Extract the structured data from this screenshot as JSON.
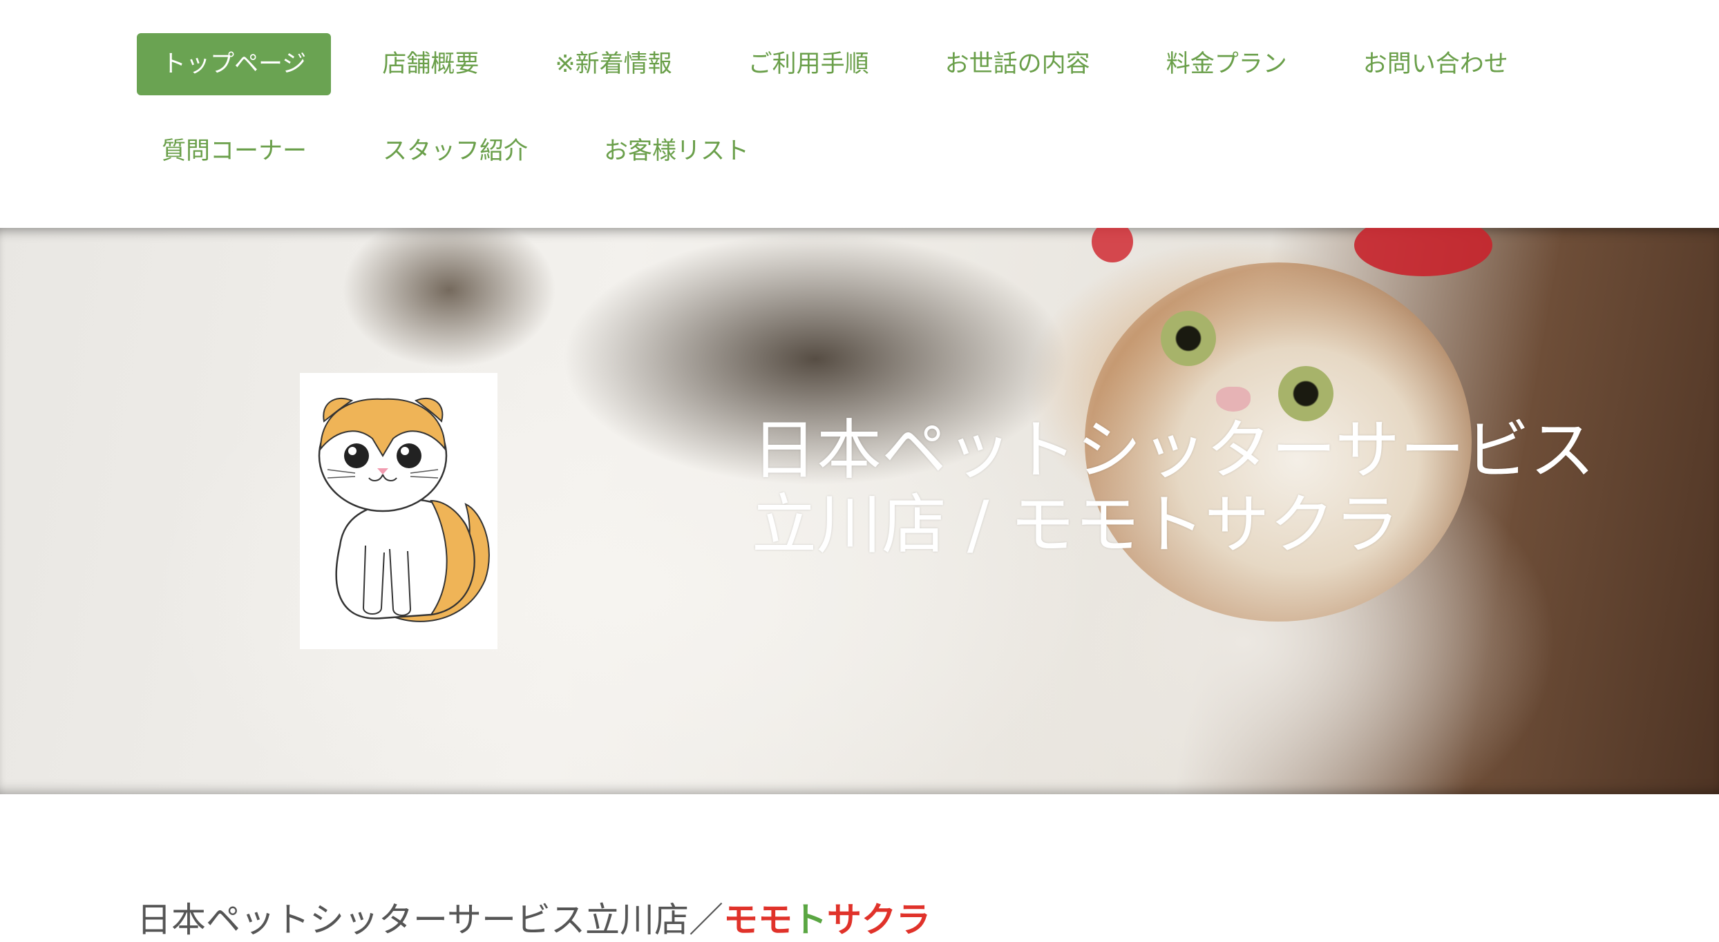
{
  "nav": {
    "items": [
      {
        "label": "トップページ",
        "active": true
      },
      {
        "label": "店舗概要"
      },
      {
        "label": "※新着情報"
      },
      {
        "label": "ご利用手順"
      },
      {
        "label": "お世話の内容"
      },
      {
        "label": "料金プラン"
      },
      {
        "label": "お問い合わせ"
      },
      {
        "label": "質問コーナー"
      },
      {
        "label": "スタッフ紹介"
      },
      {
        "label": "お客様リスト"
      }
    ]
  },
  "hero": {
    "title_line1": "日本ペットシッターサービス",
    "title_line2": "立川店 / モモトサクラ",
    "logo_icon": "cartoon-cat-icon",
    "background": "photo-calico-cat"
  },
  "heading": {
    "prefix": "日本ペットシッターサービス立川店／",
    "momo": "モモ",
    "to": "ト",
    "sakura": "サクラ"
  },
  "colors": {
    "accent_green": "#6aa352",
    "nav_text": "#6a9f4a",
    "brand_red": "#e0322a",
    "brand_green": "#5aa642"
  }
}
